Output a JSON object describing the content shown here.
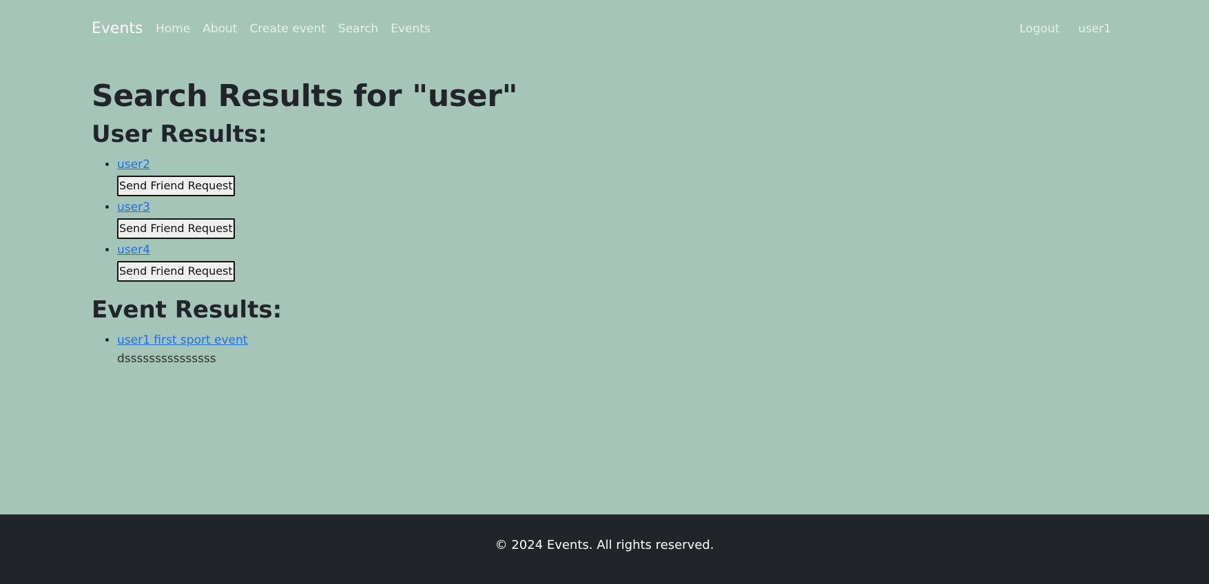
{
  "navbar": {
    "brand": "Events",
    "left_links": [
      "Home",
      "About",
      "Create event",
      "Search",
      "Events"
    ],
    "right_links": [
      "Logout",
      "user1"
    ]
  },
  "main": {
    "title": "Search Results for \"user\"",
    "user_section_heading": "User Results:",
    "users": [
      {
        "name": "user2",
        "button_label": "Send Friend Request"
      },
      {
        "name": "user3",
        "button_label": "Send Friend Request"
      },
      {
        "name": "user4",
        "button_label": "Send Friend Request"
      }
    ],
    "event_section_heading": "Event Results:",
    "events": [
      {
        "title": "user1 first sport event",
        "description": "dsssssssssssssss"
      }
    ]
  },
  "footer": {
    "text": "© 2024 Events. All rights reserved."
  },
  "colors": {
    "background": "#a5c5b8",
    "footer_bg": "#212529",
    "link": "#1f6fe0"
  }
}
